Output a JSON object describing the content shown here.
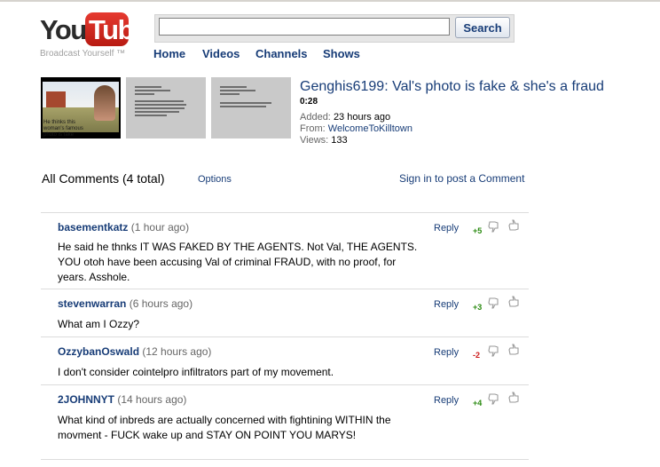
{
  "header": {
    "logo_you": "You",
    "logo_tube": "Tube",
    "tagline": "Broadcast Yourself ™",
    "search_value": "",
    "search_button": "Search",
    "nav": [
      "Home",
      "Videos",
      "Channels",
      "Shows"
    ]
  },
  "video": {
    "title": "Genghis6199: Val's photo is fake & she's a fraud",
    "duration": "0:28",
    "added_label": "Added:",
    "added": "23 hours ago",
    "from_label": "From:",
    "from": "WelcomeToKilltown",
    "views_label": "Views:",
    "views": "133",
    "thumb_caption": "He thinks this woman's famous photo is fake"
  },
  "comments_header": {
    "title": "All Comments (4 total)",
    "options": "Options",
    "sign_in": "Sign in to post a Comment"
  },
  "comments": [
    {
      "user": "basementkatz",
      "age": "(1 hour ago)",
      "text": "He said he thnks IT WAS FAKED BY THE AGENTS. Not Val, THE AGENTS. YOU otoh have been accusing Val of criminal FRAUD, with no proof, for years. Asshole.",
      "reply": "Reply",
      "score": "+5"
    },
    {
      "user": "stevenwarran",
      "age": "(6 hours ago)",
      "text": "What am I Ozzy?",
      "reply": "Reply",
      "score": "+3"
    },
    {
      "user": "OzzybanOswald",
      "age": "(12 hours ago)",
      "text": "I don't consider cointelpro infiltrators part of my movement.",
      "reply": "Reply",
      "score": "-2"
    },
    {
      "user": "2JOHNNYT",
      "age": "(14 hours ago)",
      "text": "What kind of inbreds are actually concerned with fightining WITHIN the movment - FUCK wake up and STAY ON POINT YOU MARYS!",
      "reply": "Reply",
      "score": "+4"
    }
  ],
  "colors": {
    "link": "#173c77",
    "positive": "#2a8a10",
    "negative": "#cc1a1a",
    "logo_red": "#e63a30"
  }
}
